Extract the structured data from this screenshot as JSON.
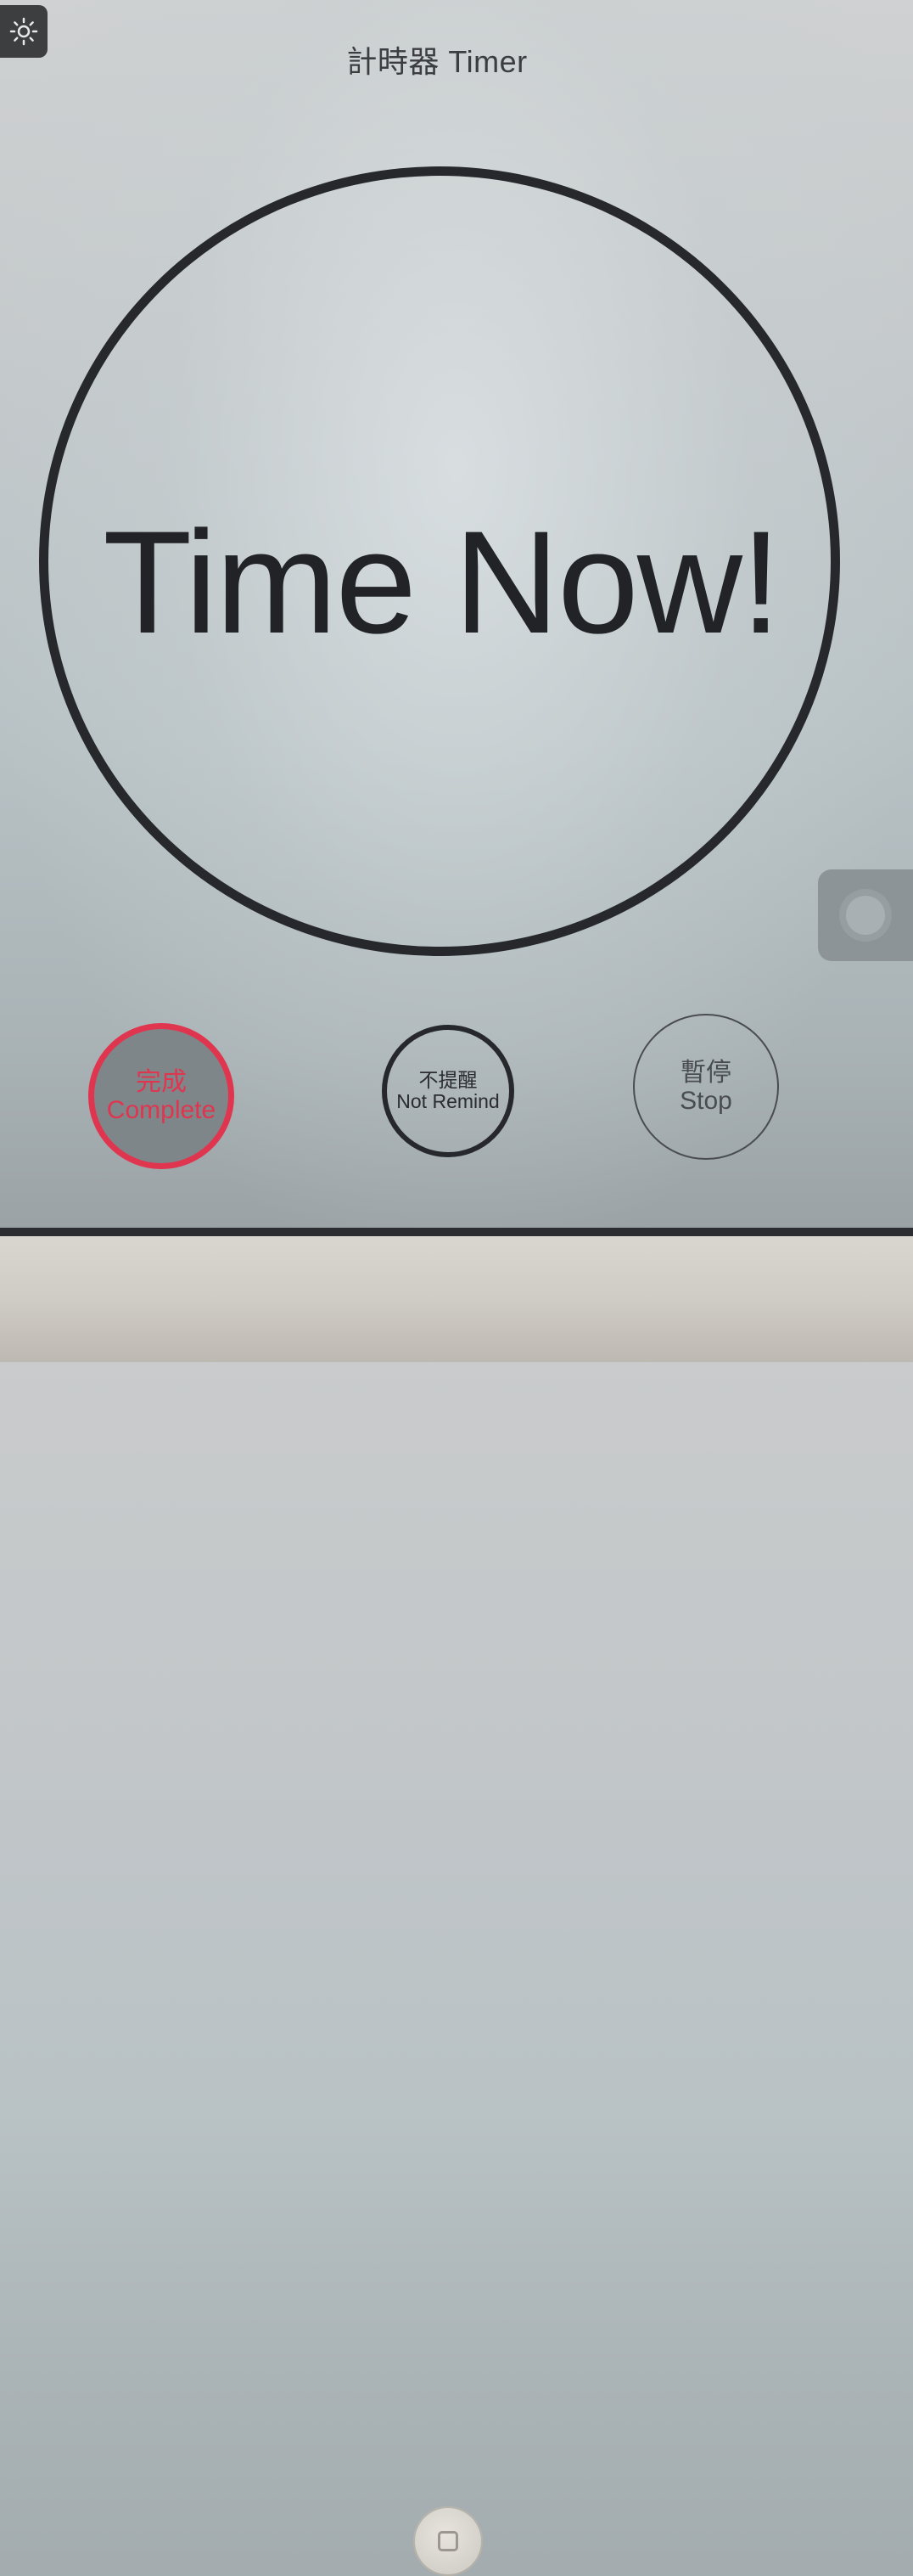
{
  "header": {
    "title": "計時器 Timer",
    "brightness_icon": "sun-icon"
  },
  "timer": {
    "display": "Time Now!"
  },
  "controls": {
    "complete": {
      "zh": "完成",
      "en": "Complete",
      "color": "#e0354f"
    },
    "not_remind": {
      "zh": "不提醒",
      "en": "Not Remind"
    },
    "stop": {
      "zh": "暫停",
      "en": "Stop"
    }
  },
  "system": {
    "assistive_touch_icon": "assistive-touch-icon",
    "home_button_icon": "home-square-icon"
  }
}
